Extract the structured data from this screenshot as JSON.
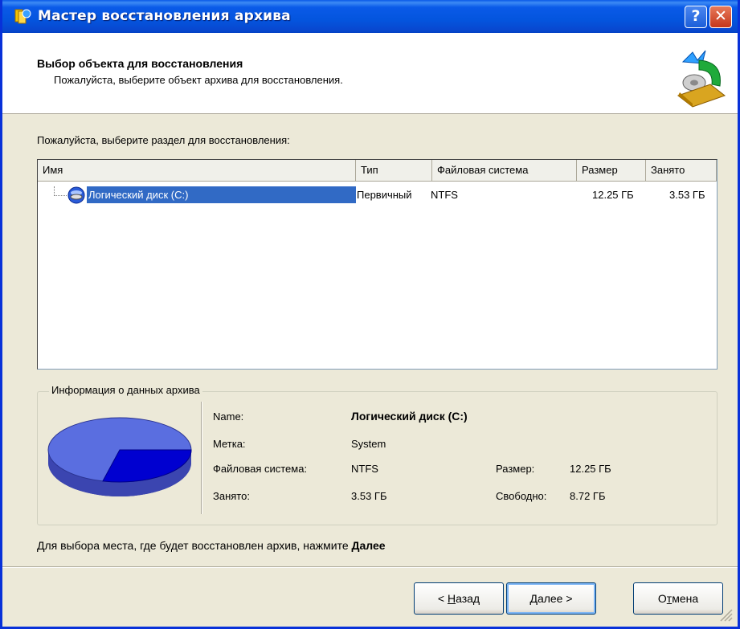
{
  "window": {
    "title": "Мастер восстановления архива"
  },
  "header": {
    "title": "Выбор объекта для восстановления",
    "subtitle": "Пожалуйста, выберите объект архива для восстановления."
  },
  "section_label": "Пожалуйста, выберите раздел для восстановления:",
  "list": {
    "columns": [
      "Имя",
      "Тип",
      "Файловая система",
      "Размер",
      "Занято"
    ],
    "rows": [
      {
        "name": "Логический диск (C:)",
        "type": "Первичный",
        "fs": "NTFS",
        "size": "12.25 ГБ",
        "used": "3.53 ГБ"
      }
    ]
  },
  "info": {
    "legend": "Информация о данных архива",
    "name_label": "Name:",
    "name_value": "Логический диск (C:)",
    "tag_label": "Метка:",
    "tag_value": "System",
    "fs_label": "Файловая система:",
    "fs_value": "NTFS",
    "size_label": "Размер:",
    "size_value": "12.25 ГБ",
    "used_label": "Занято:",
    "used_value": "3.53 ГБ",
    "free_label": "Свободно:",
    "free_value": "8.72 ГБ",
    "used_fraction": 0.288
  },
  "footer": {
    "hint_prefix": "Для выбора места, где будет восстановлен архив, нажмите",
    "hint_bold": "Далее"
  },
  "buttons": {
    "back": {
      "prefix": "< ",
      "mnemonic": "Н",
      "rest": "азад"
    },
    "next": {
      "mnemonic": "Д",
      "rest": "алее >"
    },
    "cancel": {
      "prefix": "О",
      "mnemonic": "т",
      "rest": "мена"
    }
  },
  "colors": {
    "titlebar": "#0a5ae8",
    "selection": "#316ac5",
    "pie_free": "#5a6ee0",
    "pie_used": "#0000d0"
  },
  "icons": [
    "app-icon",
    "help-icon",
    "close-icon",
    "wizard-logo-icon",
    "disk-icon",
    "pie-chart",
    "size-grip-icon"
  ]
}
